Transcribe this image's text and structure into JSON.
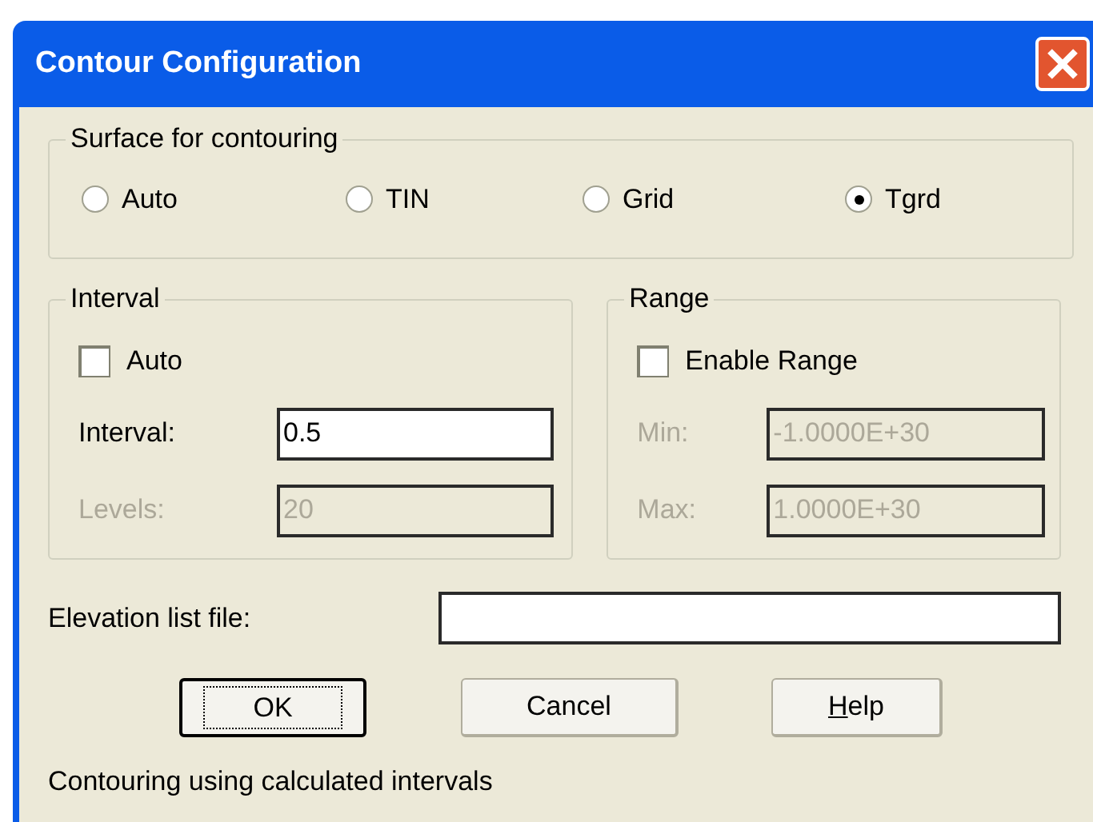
{
  "window": {
    "title": "Contour Configuration"
  },
  "surface_group": {
    "label": "Surface for contouring",
    "options": [
      {
        "label": "Auto",
        "selected": false
      },
      {
        "label": "TIN",
        "selected": false
      },
      {
        "label": "Grid",
        "selected": false
      },
      {
        "label": "Tgrd",
        "selected": true
      }
    ]
  },
  "interval_group": {
    "label": "Interval",
    "auto": {
      "label": "Auto",
      "checked": false
    },
    "fields": [
      {
        "label": "Interval:",
        "value": "0.5",
        "disabled": false
      },
      {
        "label": "Levels:",
        "value": "20",
        "disabled": true
      }
    ]
  },
  "range_group": {
    "label": "Range",
    "enable": {
      "label": "Enable Range",
      "checked": false
    },
    "fields": [
      {
        "label": "Min:",
        "value": "-1.0000E+30",
        "disabled": true
      },
      {
        "label": "Max:",
        "value": "1.0000E+30",
        "disabled": true
      }
    ]
  },
  "elevation_file": {
    "label": "Elevation list file:"
  },
  "buttons": [
    {
      "label": "OK",
      "default": true,
      "mnemonic_first": false
    },
    {
      "label": "Cancel",
      "default": false,
      "mnemonic_first": false
    },
    {
      "label": "Help",
      "default": false,
      "mnemonic_first": true
    }
  ],
  "status": "Contouring using calculated intervals"
}
